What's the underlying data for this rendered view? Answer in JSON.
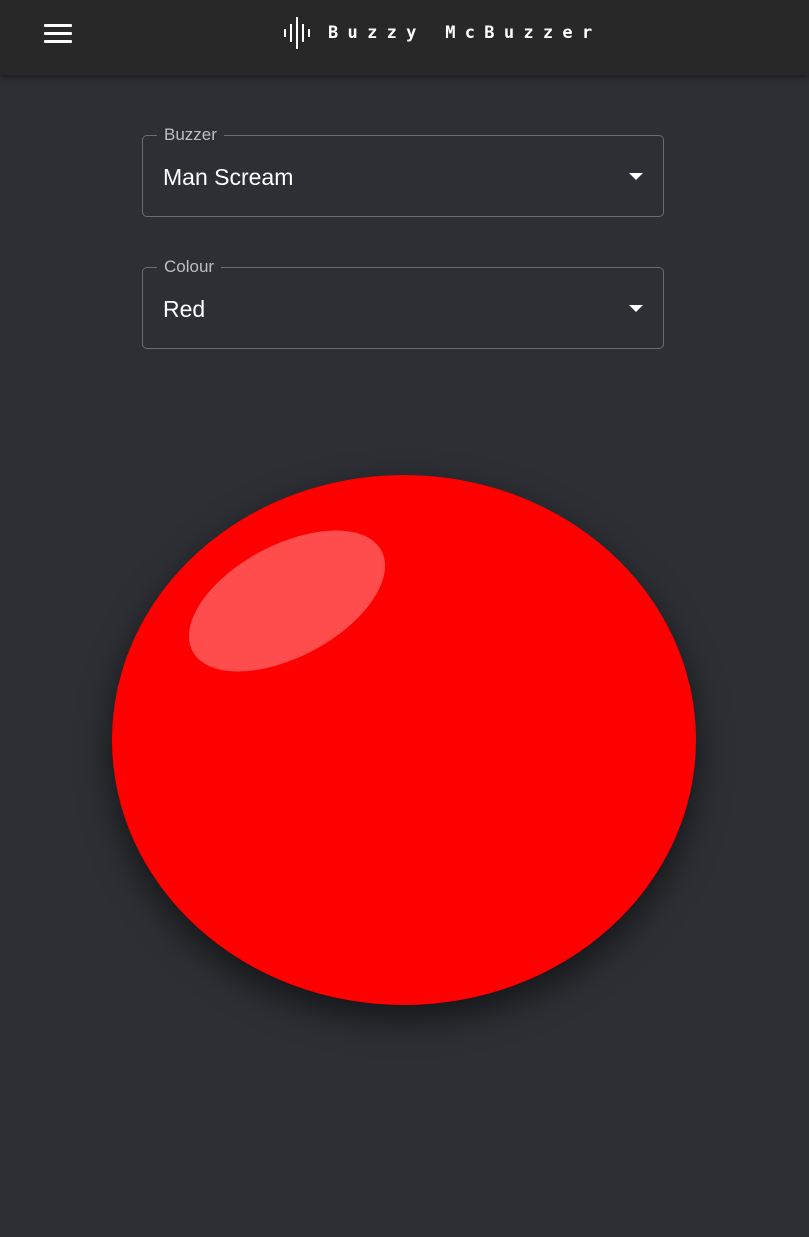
{
  "app": {
    "title": "Buzzy McBuzzer",
    "icons": {
      "menu": "hamburger-menu-icon",
      "logo": "sound-wave-icon",
      "dropdown": "caret-down-icon"
    }
  },
  "controls": {
    "buzzer": {
      "label": "Buzzer",
      "value": "Man Scream"
    },
    "colour": {
      "label": "Colour",
      "value": "Red"
    }
  },
  "buzzer_button": {
    "colour": "#ff0000",
    "highlight": "rgba(255,255,255,0.3)"
  },
  "theme": {
    "background": "#2d2f34",
    "appbar": "#282828",
    "text": "#ffffff",
    "label": "#bdbec1",
    "outline": "#6b6d72"
  }
}
